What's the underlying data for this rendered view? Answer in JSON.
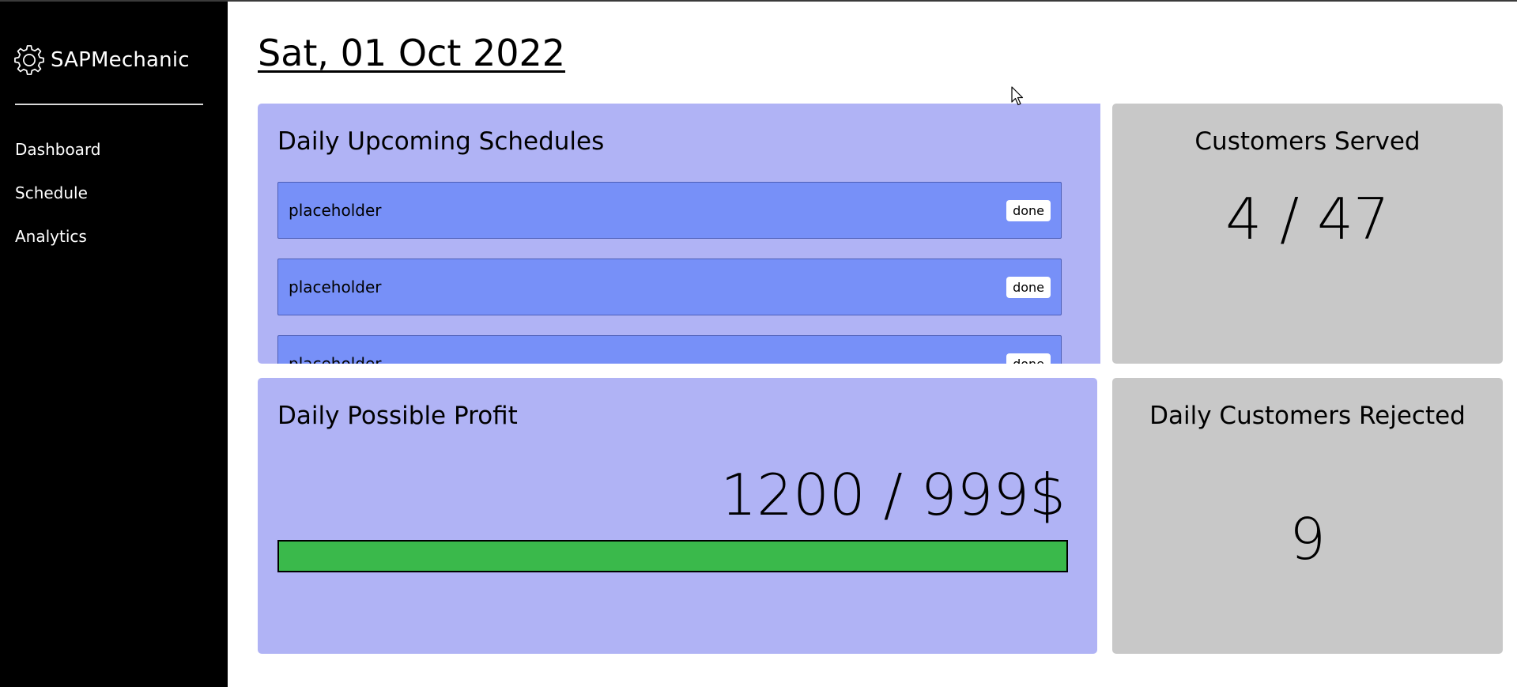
{
  "app": {
    "name": "SAPMechanic"
  },
  "sidebar": {
    "items": [
      {
        "label": "Dashboard"
      },
      {
        "label": "Schedule"
      },
      {
        "label": "Analytics"
      }
    ]
  },
  "page": {
    "title": "Sat, 01 Oct 2022"
  },
  "schedules": {
    "title": "Daily Upcoming Schedules",
    "items": [
      {
        "label": "placeholder",
        "action": "done"
      },
      {
        "label": "placeholder",
        "action": "done"
      },
      {
        "label": "placeholder",
        "action": "done"
      }
    ]
  },
  "customers_served": {
    "title": "Customers Served",
    "value": "4 / 47"
  },
  "profit": {
    "title": "Daily Possible Profit",
    "value": "1200 / 999$",
    "progress_fraction": 1.0
  },
  "customers_rejected": {
    "title": "Daily Customers Rejected",
    "value": "9"
  },
  "colors": {
    "sidebar_bg": "#000000",
    "card_blue": "#b0b3f5",
    "schedule_item": "#7790f8",
    "card_gray": "#c8c8c8",
    "progress_green": "#3ab94b"
  },
  "icons": {
    "brand": "gear-icon"
  }
}
